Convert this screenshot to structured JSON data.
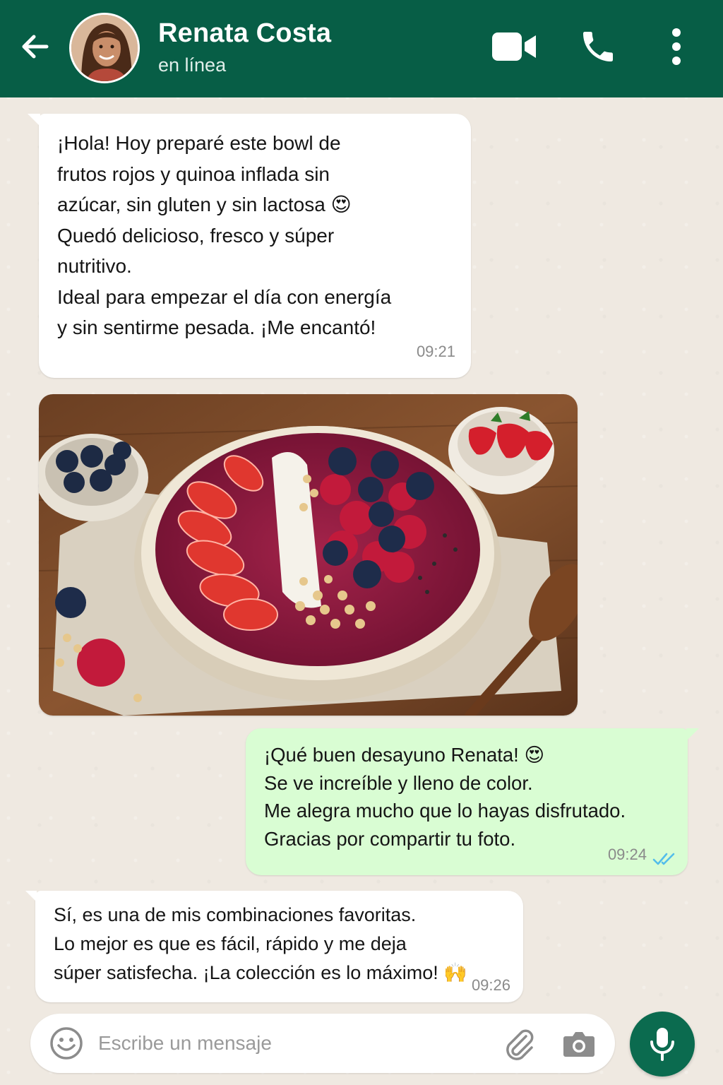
{
  "header": {
    "contact_name": "Renata Costa",
    "status": "en línea"
  },
  "messages": [
    {
      "direction": "incoming",
      "text": "¡Hola! Hoy preparé este bowl de\nfrutos rojos y quinoa inflada sin\nazúcar, sin gluten y sin lactosa 😍\nQuedó delicioso, fresco y súper\nnutritivo.\nIdeal para empezar el día con energía\ny sin sentirme pesada. ¡Me encantó!",
      "time": "09:21"
    },
    {
      "direction": "outgoing",
      "text": "¡Qué buen desayuno Renata! 😍\nSe ve increíble y lleno de color.\nMe alegra mucho que lo hayas disfrutado.\nGracias por compartir tu foto.",
      "time": "09:24",
      "status_icon": "double-check-read-icon"
    },
    {
      "direction": "incoming",
      "text": "Sí, es una de mis combinaciones favoritas.\nLo mejor es que es fácil, rápido y me deja\nsúper satisfecha. ¡La colección es lo máximo! 🙌",
      "time": "09:26"
    }
  ],
  "composer": {
    "placeholder": "Escribe un mensaje"
  },
  "colors": {
    "header_bg": "#075e46",
    "outgoing_bubble": "#d9fdd3",
    "incoming_bubble": "#ffffff",
    "chat_bg": "#efe9e1",
    "mic_button": "#0b6b4f",
    "read_ticks": "#53bdeb"
  },
  "icons": [
    "back-arrow-icon",
    "video-call-icon",
    "phone-icon",
    "more-vertical-icon",
    "emoji-icon",
    "attach-icon",
    "camera-icon",
    "mic-icon"
  ]
}
